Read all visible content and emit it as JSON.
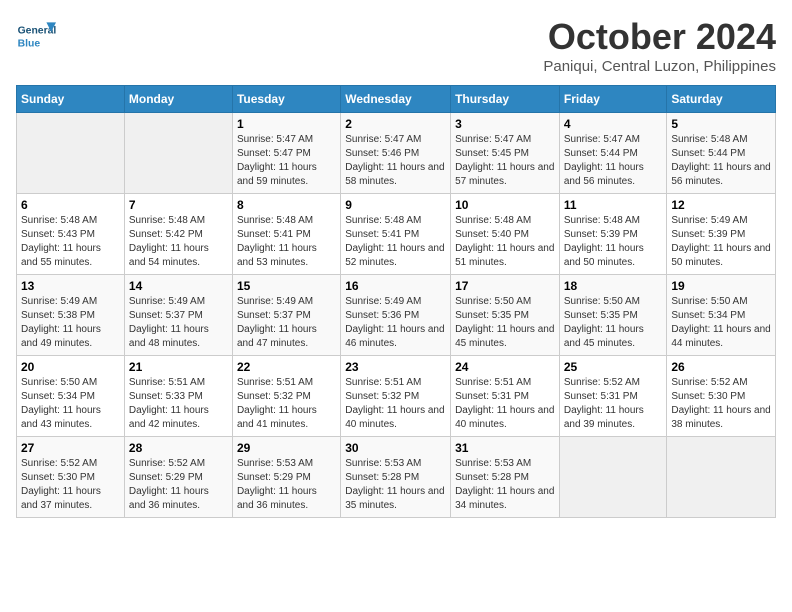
{
  "header": {
    "logo_general": "General",
    "logo_blue": "Blue",
    "month": "October 2024",
    "location": "Paniqui, Central Luzon, Philippines"
  },
  "weekdays": [
    "Sunday",
    "Monday",
    "Tuesday",
    "Wednesday",
    "Thursday",
    "Friday",
    "Saturday"
  ],
  "weeks": [
    [
      {
        "day": "",
        "details": ""
      },
      {
        "day": "",
        "details": ""
      },
      {
        "day": "1",
        "details": "Sunrise: 5:47 AM\nSunset: 5:47 PM\nDaylight: 11 hours and 59 minutes."
      },
      {
        "day": "2",
        "details": "Sunrise: 5:47 AM\nSunset: 5:46 PM\nDaylight: 11 hours and 58 minutes."
      },
      {
        "day": "3",
        "details": "Sunrise: 5:47 AM\nSunset: 5:45 PM\nDaylight: 11 hours and 57 minutes."
      },
      {
        "day": "4",
        "details": "Sunrise: 5:47 AM\nSunset: 5:44 PM\nDaylight: 11 hours and 56 minutes."
      },
      {
        "day": "5",
        "details": "Sunrise: 5:48 AM\nSunset: 5:44 PM\nDaylight: 11 hours and 56 minutes."
      }
    ],
    [
      {
        "day": "6",
        "details": "Sunrise: 5:48 AM\nSunset: 5:43 PM\nDaylight: 11 hours and 55 minutes."
      },
      {
        "day": "7",
        "details": "Sunrise: 5:48 AM\nSunset: 5:42 PM\nDaylight: 11 hours and 54 minutes."
      },
      {
        "day": "8",
        "details": "Sunrise: 5:48 AM\nSunset: 5:41 PM\nDaylight: 11 hours and 53 minutes."
      },
      {
        "day": "9",
        "details": "Sunrise: 5:48 AM\nSunset: 5:41 PM\nDaylight: 11 hours and 52 minutes."
      },
      {
        "day": "10",
        "details": "Sunrise: 5:48 AM\nSunset: 5:40 PM\nDaylight: 11 hours and 51 minutes."
      },
      {
        "day": "11",
        "details": "Sunrise: 5:48 AM\nSunset: 5:39 PM\nDaylight: 11 hours and 50 minutes."
      },
      {
        "day": "12",
        "details": "Sunrise: 5:49 AM\nSunset: 5:39 PM\nDaylight: 11 hours and 50 minutes."
      }
    ],
    [
      {
        "day": "13",
        "details": "Sunrise: 5:49 AM\nSunset: 5:38 PM\nDaylight: 11 hours and 49 minutes."
      },
      {
        "day": "14",
        "details": "Sunrise: 5:49 AM\nSunset: 5:37 PM\nDaylight: 11 hours and 48 minutes."
      },
      {
        "day": "15",
        "details": "Sunrise: 5:49 AM\nSunset: 5:37 PM\nDaylight: 11 hours and 47 minutes."
      },
      {
        "day": "16",
        "details": "Sunrise: 5:49 AM\nSunset: 5:36 PM\nDaylight: 11 hours and 46 minutes."
      },
      {
        "day": "17",
        "details": "Sunrise: 5:50 AM\nSunset: 5:35 PM\nDaylight: 11 hours and 45 minutes."
      },
      {
        "day": "18",
        "details": "Sunrise: 5:50 AM\nSunset: 5:35 PM\nDaylight: 11 hours and 45 minutes."
      },
      {
        "day": "19",
        "details": "Sunrise: 5:50 AM\nSunset: 5:34 PM\nDaylight: 11 hours and 44 minutes."
      }
    ],
    [
      {
        "day": "20",
        "details": "Sunrise: 5:50 AM\nSunset: 5:34 PM\nDaylight: 11 hours and 43 minutes."
      },
      {
        "day": "21",
        "details": "Sunrise: 5:51 AM\nSunset: 5:33 PM\nDaylight: 11 hours and 42 minutes."
      },
      {
        "day": "22",
        "details": "Sunrise: 5:51 AM\nSunset: 5:32 PM\nDaylight: 11 hours and 41 minutes."
      },
      {
        "day": "23",
        "details": "Sunrise: 5:51 AM\nSunset: 5:32 PM\nDaylight: 11 hours and 40 minutes."
      },
      {
        "day": "24",
        "details": "Sunrise: 5:51 AM\nSunset: 5:31 PM\nDaylight: 11 hours and 40 minutes."
      },
      {
        "day": "25",
        "details": "Sunrise: 5:52 AM\nSunset: 5:31 PM\nDaylight: 11 hours and 39 minutes."
      },
      {
        "day": "26",
        "details": "Sunrise: 5:52 AM\nSunset: 5:30 PM\nDaylight: 11 hours and 38 minutes."
      }
    ],
    [
      {
        "day": "27",
        "details": "Sunrise: 5:52 AM\nSunset: 5:30 PM\nDaylight: 11 hours and 37 minutes."
      },
      {
        "day": "28",
        "details": "Sunrise: 5:52 AM\nSunset: 5:29 PM\nDaylight: 11 hours and 36 minutes."
      },
      {
        "day": "29",
        "details": "Sunrise: 5:53 AM\nSunset: 5:29 PM\nDaylight: 11 hours and 36 minutes."
      },
      {
        "day": "30",
        "details": "Sunrise: 5:53 AM\nSunset: 5:28 PM\nDaylight: 11 hours and 35 minutes."
      },
      {
        "day": "31",
        "details": "Sunrise: 5:53 AM\nSunset: 5:28 PM\nDaylight: 11 hours and 34 minutes."
      },
      {
        "day": "",
        "details": ""
      },
      {
        "day": "",
        "details": ""
      }
    ]
  ]
}
